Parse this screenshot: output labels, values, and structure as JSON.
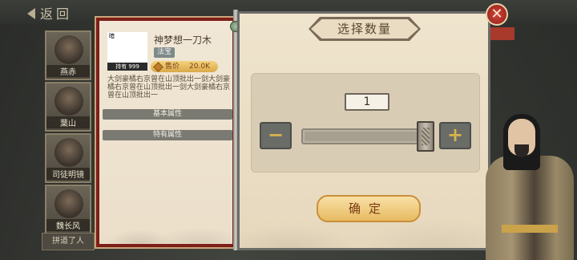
{
  "header": {
    "back_label": "返回"
  },
  "characters": [
    {
      "name": "燕赤"
    },
    {
      "name": "葉山"
    },
    {
      "name": "司徒明镜"
    },
    {
      "name": "魏长风"
    }
  ],
  "bottom_tab": "拼道了人",
  "item": {
    "thumb_tag": "暗",
    "hold_count": "持有 999",
    "name": "神梦想一刀木",
    "type": "法宝",
    "price_label": "售价",
    "price_value": "20.0K",
    "description": "大剑豪橘右京曾在山顶批出一剑大剑豪橘右京曾在山顶批出一剑大剑豪橘右京曾在山顶批出一",
    "basic_attr_label": "基本属性",
    "special_attr_label": "特有属性"
  },
  "dialog": {
    "title": "选择数量",
    "quantity": "1",
    "quantity_fill": 1.0,
    "minus_label": "−",
    "plus_label": "+",
    "confirm_label": "确定",
    "close_label": "✕"
  },
  "colors": {
    "panel_border_red": "#7d1f18",
    "confirm_gold": "#e7bb62",
    "close_red": "#d2453a",
    "step_icon": "#d7b34c"
  }
}
